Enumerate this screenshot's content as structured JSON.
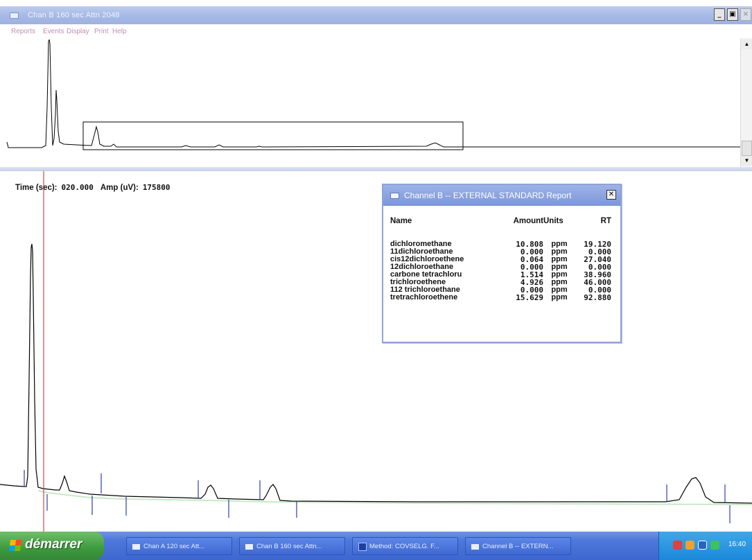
{
  "window": {
    "title": "Chan B  160 sec  Attn 2048",
    "min_label": "_",
    "max_label": "▣",
    "close_label": "×"
  },
  "menu": {
    "items": [
      "Reports",
      "Events",
      "Display",
      "Print",
      "Help"
    ]
  },
  "overview_scroll": {
    "up_label": "▲",
    "down_label": "▼"
  },
  "readout": {
    "time_label": "Time (sec):",
    "time_value": "020.000",
    "amp_label": "Amp (uV):",
    "amp_value": "175800"
  },
  "report": {
    "title": "Channel B -- EXTERNAL STANDARD Report",
    "close_label": "✕",
    "headers": {
      "name": "Name",
      "amount": "Amount",
      "units": "Units",
      "rt": "RT"
    },
    "rows": [
      {
        "name": "dichloromethane",
        "amount": "10.808",
        "units": "ppm",
        "rt": "19.120"
      },
      {
        "name": "11dichloroethane",
        "amount": "0.000",
        "units": "ppm",
        "rt": "0.000"
      },
      {
        "name": "cis12dichloroethene",
        "amount": "0.064",
        "units": "ppm",
        "rt": "27.040"
      },
      {
        "name": "12dichloroethane",
        "amount": "0.000",
        "units": "ppm",
        "rt": "0.000"
      },
      {
        "name": "carbone tetrachloru",
        "amount": "1.514",
        "units": "ppm",
        "rt": "38.960"
      },
      {
        "name": "trichloroethene",
        "amount": "4.926",
        "units": "ppm",
        "rt": "46.000"
      },
      {
        "name": "112 trichloroethane",
        "amount": "0.000",
        "units": "ppm",
        "rt": "0.000"
      },
      {
        "name": "tretrachloroethene",
        "amount": "15.629",
        "units": "ppm",
        "rt": "92.880"
      }
    ]
  },
  "taskbar": {
    "start_label": "démarrer",
    "tasks": [
      {
        "label": "Chan A  120 sec  Att..."
      },
      {
        "label": "Chan B  160 sec  Attn..."
      },
      {
        "label": "Method: COVSELG.  F..."
      },
      {
        "label": "Channel B -- EXTERN..."
      }
    ],
    "clock": "16:40"
  },
  "colors": {
    "trace": "#000000",
    "cursor": "#cc2222",
    "baseline_fill": "#5fbf5f",
    "titlebar": "#a6b9e6",
    "taskbar": "#3e67cf",
    "start_button": "#3d9a3d"
  }
}
